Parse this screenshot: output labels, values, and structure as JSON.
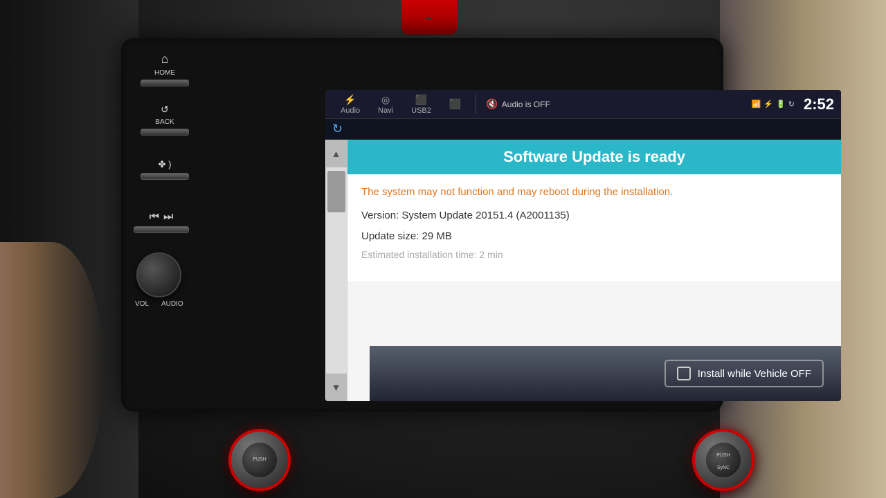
{
  "background": {
    "color": "#1a1a1a"
  },
  "statusBar": {
    "tabs": [
      {
        "id": "audio",
        "label": "Audio",
        "icon": "⚡",
        "active": false
      },
      {
        "id": "navi",
        "label": "Navi",
        "icon": "◎",
        "active": false
      },
      {
        "id": "usb2",
        "label": "USB2",
        "icon": "⬛",
        "active": false
      },
      {
        "id": "usb",
        "label": "",
        "icon": "⬛",
        "active": false
      }
    ],
    "audioStatus": "Audio is OFF",
    "time": "2:52"
  },
  "physicalButtons": {
    "home": "HOME",
    "back": "BACK",
    "vol": "VOL",
    "audio": "AUDIO"
  },
  "updateScreen": {
    "title": "Software Update is ready",
    "warningText": "The system may not function and may reboot during the installation.",
    "version": "Version: System Update 20151.4 (A2001135)",
    "updateSize": "Update size: 29 MB",
    "estimatedTime": "Estimated installation time: 2 min",
    "installWhileOff": "Install while Vehicle OFF"
  },
  "pushSync": {
    "line1": "PUSH",
    "line2": "SyNC"
  },
  "pushButton": {
    "label": "PUSH"
  }
}
